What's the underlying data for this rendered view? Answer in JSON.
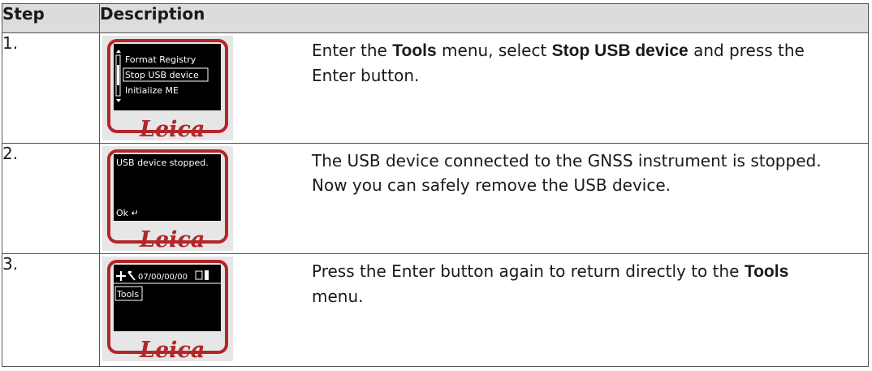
{
  "header": {
    "step": "Step",
    "description": "Description"
  },
  "rows": [
    {
      "step": "1.",
      "screen": {
        "lines": [
          "Format Registry",
          "Stop USB device",
          "Initialize ME"
        ],
        "logo": "Leica"
      },
      "desc": {
        "a": "Enter the ",
        "b": "Tools",
        "c": " menu, select ",
        "d": "Stop USB device",
        "e": " and press the Enter button."
      }
    },
    {
      "step": "2.",
      "screen": {
        "line1": "USB device stopped.",
        "line2": "Ok ↵",
        "logo": "Leica"
      },
      "desc": {
        "a": "The USB device connected to the GNSS instrument is stopped. Now you can safely remove the USB device."
      }
    },
    {
      "step": "3.",
      "screen": {
        "status": "07/00/00/00",
        "line": "Tools",
        "logo": "Leica"
      },
      "desc": {
        "a": "Press the Enter button again to return directly to the ",
        "b": "Tools",
        "c": " menu."
      }
    }
  ],
  "colors": {
    "header_bg": "#dcdcdc",
    "frame_red": "#b3262a",
    "lcd_bg": "#000000",
    "bezel_bg": "#e6e6e6"
  }
}
